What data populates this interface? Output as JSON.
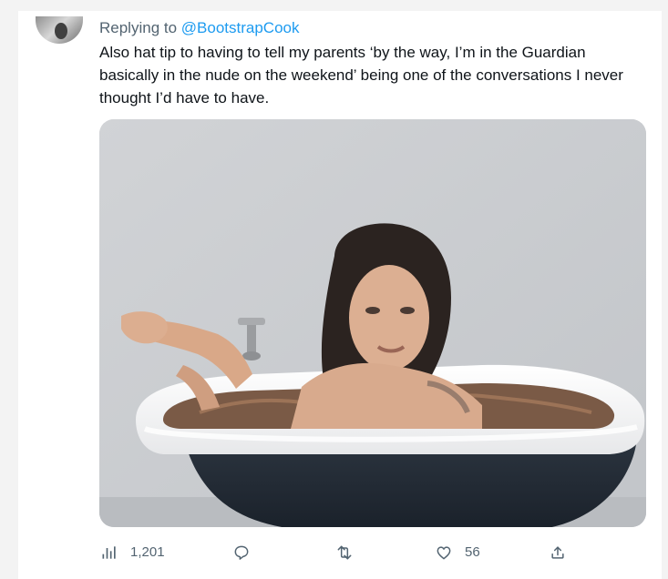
{
  "tweet": {
    "replying_prefix": "Replying to ",
    "replying_handle": "@BootstrapCook",
    "text": "Also hat tip to having to tell my parents ‘by the way, I’m in the Guardian basically in the nude on the weekend’ being one of the conversations I never thought I’d have to have."
  },
  "actions": {
    "views_count": "1,201",
    "likes_count": "56",
    "icons": {
      "views": "bar-chart-icon",
      "reply": "speech-bubble-icon",
      "retweet": "retweet-icon",
      "like": "heart-icon",
      "share": "upload-icon"
    }
  },
  "colors": {
    "text": "#0f1419",
    "secondary": "#536471",
    "link": "#1d9bf0"
  }
}
